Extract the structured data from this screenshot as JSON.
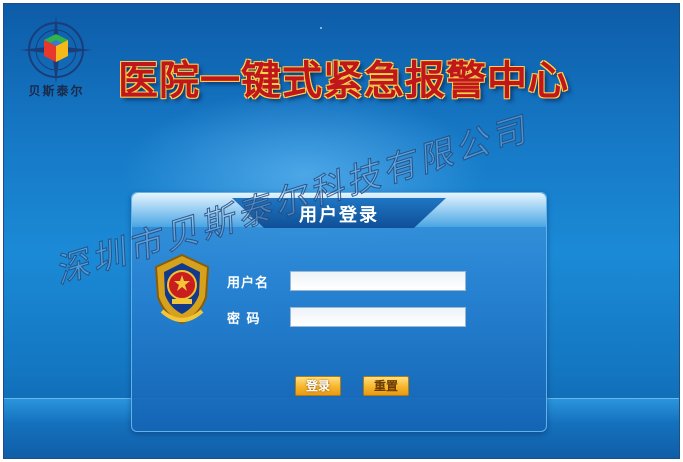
{
  "header": {
    "logo_text": "贝斯泰尔",
    "title": "医院一键式紧急报警中心"
  },
  "login": {
    "title": "用户登录",
    "username_label": "用户名",
    "password_label": "密 码",
    "username_value": "",
    "password_value": "",
    "login_button": "登录",
    "reset_button": "重置"
  },
  "watermark": "深圳市贝斯泰尔科技有限公司",
  "colors": {
    "background": "#1679c6",
    "title_red": "#c0171c",
    "button_orange": "#f7b52b"
  },
  "icons": {
    "logo": "cube-compass-logo-icon",
    "emblem": "police-emblem-icon"
  }
}
